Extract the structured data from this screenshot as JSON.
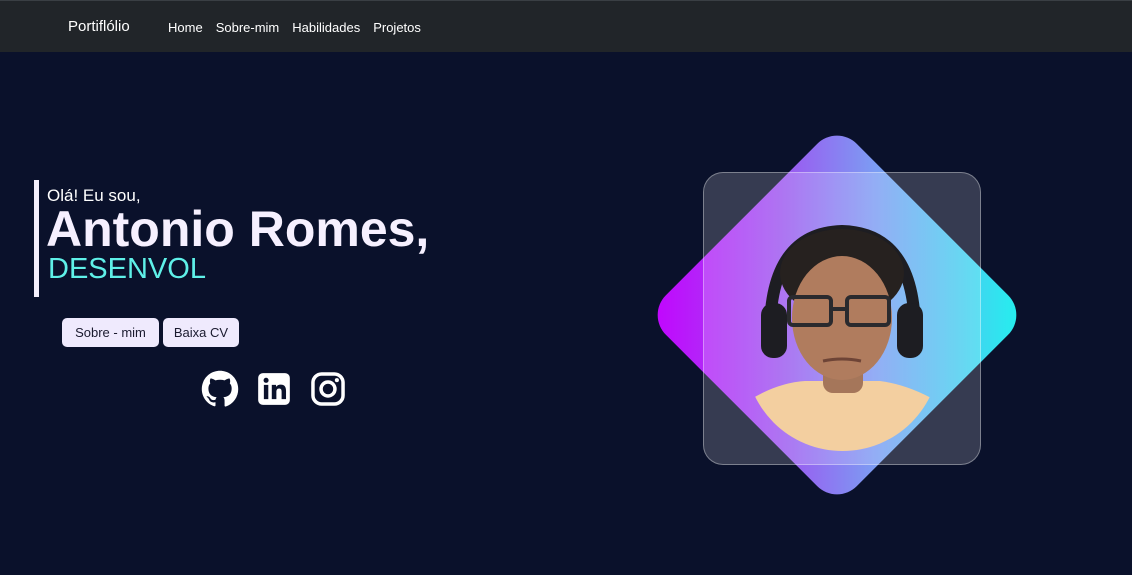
{
  "navbar": {
    "brand": "Portiflólio",
    "links": [
      "Home",
      "Sobre-mim",
      "Habilidades",
      "Projetos"
    ]
  },
  "hero": {
    "greeting": "Olá! Eu sou,",
    "name": "Antonio Romes,",
    "role": "DESENVOL",
    "buttons": {
      "about": "Sobre - mim",
      "cv": "Baixa CV"
    },
    "social": [
      "github-icon",
      "linkedin-icon",
      "instagram-icon"
    ]
  },
  "colors": {
    "navbar_bg": "#212529",
    "page_bg": "#0a112b",
    "accent_cyan": "#5ff0e8",
    "gradient_top": "#c400ff",
    "gradient_bottom": "#1ff4ee"
  }
}
